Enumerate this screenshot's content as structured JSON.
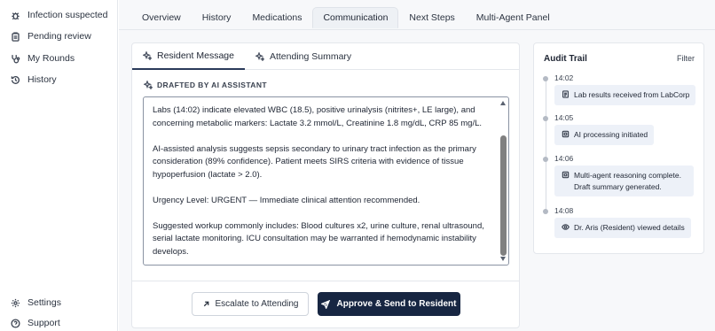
{
  "sidebar": {
    "items": [
      {
        "label": "Infection suspected",
        "icon": "bug-icon"
      },
      {
        "label": "Pending review",
        "icon": "clipboard-icon"
      },
      {
        "label": "My Rounds",
        "icon": "stethoscope-icon"
      },
      {
        "label": "History",
        "icon": "history-icon"
      }
    ],
    "bottom": [
      {
        "label": "Settings",
        "icon": "gear-icon"
      },
      {
        "label": "Support",
        "icon": "help-icon"
      }
    ]
  },
  "tabs": [
    {
      "label": "Overview",
      "active": false
    },
    {
      "label": "History",
      "active": false
    },
    {
      "label": "Medications",
      "active": false
    },
    {
      "label": "Communication",
      "active": true
    },
    {
      "label": "Next Steps",
      "active": false
    },
    {
      "label": "Multi-Agent Panel",
      "active": false
    }
  ],
  "communication": {
    "subtabs": [
      {
        "label": "Resident Message",
        "icon": "sparkle-icon",
        "active": true
      },
      {
        "label": "Attending Summary",
        "icon": "sparkle-icon",
        "active": false
      }
    ],
    "drafted_label": "DRAFTED BY AI ASSISTANT",
    "message_paragraphs": [
      "Labs (14:02) indicate elevated WBC (18.5), positive urinalysis (nitrites+, LE large), and concerning metabolic markers: Lactate 3.2 mmol/L, Creatinine 1.8 mg/dL, CRP 85 mg/L.",
      "AI-assisted analysis suggests sepsis secondary to urinary tract infection as the primary consideration (89% confidence). Patient meets SIRS criteria with evidence of tissue hypoperfusion (lactate > 2.0).",
      "Urgency Level: URGENT — Immediate clinical attention recommended.",
      "Suggested workup commonly includes: Blood cultures x2, urine culture, renal ultrasound, serial lactate monitoring. ICU consultation may be warranted if hemodynamic instability develops."
    ],
    "escalate_label": "Escalate to Attending",
    "approve_label": "Approve & Send to Resident"
  },
  "audit": {
    "title": "Audit Trail",
    "filter_label": "Filter",
    "entries": [
      {
        "time": "14:02",
        "icon": "document-icon",
        "text": "Lab results received from LabCorp"
      },
      {
        "time": "14:05",
        "icon": "chip-icon",
        "text": "AI processing initiated"
      },
      {
        "time": "14:06",
        "icon": "chip-icon",
        "text": "Multi-agent reasoning complete. Draft summary generated."
      },
      {
        "time": "14:08",
        "icon": "eye-icon",
        "text": "Dr. Aris (Resident) viewed details"
      }
    ]
  }
}
